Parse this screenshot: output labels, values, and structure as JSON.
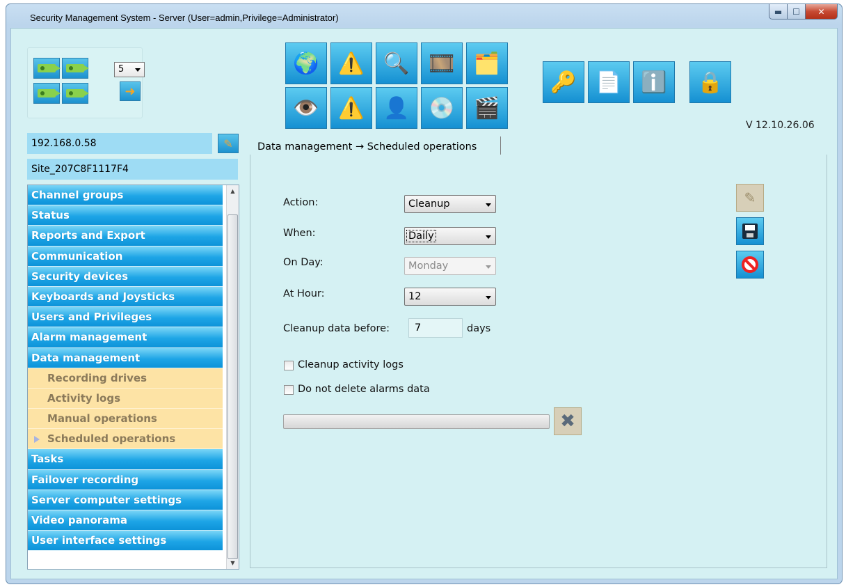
{
  "window": {
    "title": "Security Management System - Server (User=admin,Privilege=Administrator)",
    "controls": [
      "minimize",
      "maximize",
      "close"
    ]
  },
  "camera_panel": {
    "camera_buttons": [
      "camera-icon",
      "camera-icon",
      "camera-icon",
      "camera-icon"
    ],
    "layout_value": "5",
    "go_icon": "arrow-right-icon"
  },
  "toolbar": {
    "row1": [
      "globe-icon",
      "warning-icon",
      "magnifier-icon",
      "film-star-icon",
      "windows-icon"
    ],
    "row2": [
      "eye-icon",
      "alarm-warning-icon",
      "user-icon",
      "disc-export-icon",
      "film-edit-icon"
    ],
    "right": [
      "key-icon",
      "help-document-icon",
      "info-icon",
      "lock-icon"
    ]
  },
  "version": "V 12.10.26.06",
  "server": {
    "ip": "192.168.0.58",
    "site": "Site_207C8F1117F4"
  },
  "nav": {
    "items": [
      {
        "label": "Channel groups",
        "type": "group"
      },
      {
        "label": "Status",
        "type": "group"
      },
      {
        "label": "Reports and Export",
        "type": "group"
      },
      {
        "label": "Communication",
        "type": "group"
      },
      {
        "label": "Security devices",
        "type": "group"
      },
      {
        "label": "Keyboards and Joysticks",
        "type": "group"
      },
      {
        "label": "Users and Privileges",
        "type": "group"
      },
      {
        "label": "Alarm management",
        "type": "group"
      },
      {
        "label": "Data management",
        "type": "group"
      },
      {
        "label": "Recording drives",
        "type": "sub"
      },
      {
        "label": "Activity logs",
        "type": "sub"
      },
      {
        "label": "Manual operations",
        "type": "sub"
      },
      {
        "label": "Scheduled operations",
        "type": "sub",
        "selected": true
      },
      {
        "label": "Tasks",
        "type": "group"
      },
      {
        "label": "Failover recording",
        "type": "group"
      },
      {
        "label": "Server computer settings",
        "type": "group"
      },
      {
        "label": "Video panorama",
        "type": "group"
      },
      {
        "label": "User interface settings",
        "type": "group"
      }
    ]
  },
  "tab": {
    "label": "Data management → Scheduled operations"
  },
  "form": {
    "action_label": "Action:",
    "action_value": "Cleanup",
    "when_label": "When:",
    "when_value": "Daily",
    "onday_label": "On Day:",
    "onday_value": "Monday",
    "athour_label": "At Hour:",
    "athour_value": "12",
    "cleanup_before_label": "Cleanup data before:",
    "cleanup_before_value": "7",
    "cleanup_before_unit": "days",
    "cleanup_logs_label": "Cleanup activity logs",
    "cleanup_logs_checked": false,
    "keep_alarms_label": "Do not delete alarms data",
    "keep_alarms_checked": false,
    "progress": 0
  },
  "side_actions": [
    "pencil-icon",
    "save-icon",
    "cancel-icon"
  ],
  "colors": {
    "client_bg": "#d5f1f3",
    "nav_group": "#1ea5e6",
    "nav_sub": "#fde3a5",
    "tool_button": "#1590d2"
  }
}
